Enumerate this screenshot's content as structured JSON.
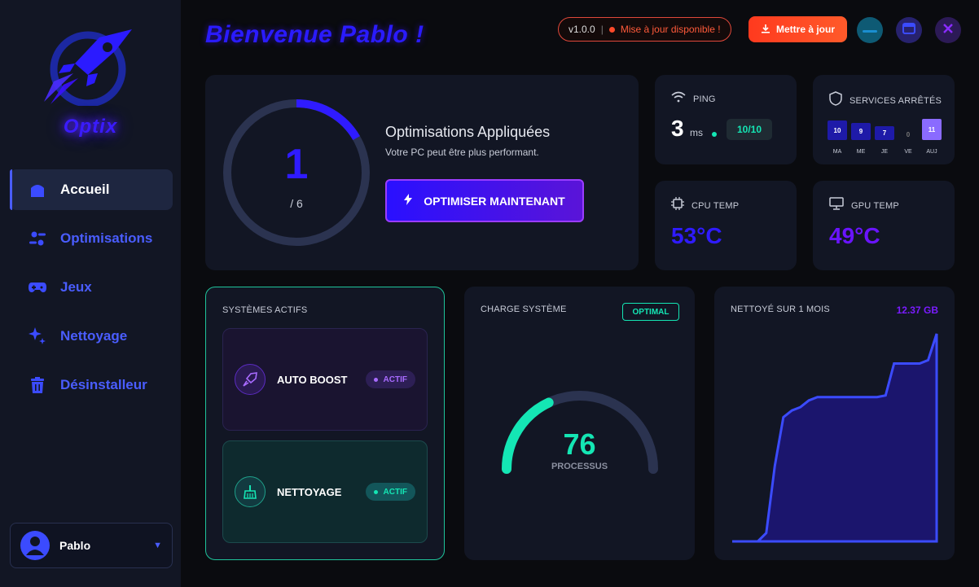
{
  "app": {
    "brand": "Optix"
  },
  "sidebar": {
    "items": [
      {
        "label": "Accueil",
        "icon": "home-icon",
        "active": true
      },
      {
        "label": "Optimisations",
        "icon": "sliders-icon",
        "active": false
      },
      {
        "label": "Jeux",
        "icon": "gamepad-icon",
        "active": false
      },
      {
        "label": "Nettoyage",
        "icon": "sparkles-icon",
        "active": false
      },
      {
        "label": "Désinstalleur",
        "icon": "trash-icon",
        "active": false
      }
    ],
    "user": {
      "name": "Pablo"
    }
  },
  "header": {
    "welcome": "Bienvenue Pablo !",
    "version": "v1.0.0",
    "separator": "|",
    "update_notice": "Mise à jour disponible !",
    "update_button": "Mettre à jour"
  },
  "optimizations": {
    "applied": "1",
    "total_label": "/ 6",
    "progress": 0.1667,
    "title": "Optimisations Appliquées",
    "subtitle": "Votre PC peut être plus performant.",
    "button": "OPTIMISER MAINTENANT"
  },
  "ping": {
    "title": "PING",
    "value": "3",
    "unit": "ms",
    "score": "10/10"
  },
  "services": {
    "title": "SERVICES ARRÊTÉS",
    "days": [
      {
        "label": "MA",
        "value": "10"
      },
      {
        "label": "ME",
        "value": "9"
      },
      {
        "label": "JE",
        "value": "7"
      },
      {
        "label": "VE",
        "value": "0"
      },
      {
        "label": "AUJ",
        "value": "11"
      }
    ]
  },
  "cpu": {
    "title": "CPU TEMP",
    "value": "53°C"
  },
  "gpu": {
    "title": "GPU TEMP",
    "value": "49°C"
  },
  "systems": {
    "title": "SYSTÈMES ACTIFS",
    "items": [
      {
        "label": "AUTO BOOST",
        "status": "ACTIF",
        "icon": "rocket-icon"
      },
      {
        "label": "NETTOYAGE",
        "status": "ACTIF",
        "icon": "broom-icon"
      }
    ]
  },
  "load": {
    "title": "CHARGE SYSTÈME",
    "badge": "OPTIMAL",
    "value": "76",
    "label": "PROCESSUS",
    "fraction": 0.36
  },
  "cleaned": {
    "title": "NETTOYÉ SUR 1 MOIS",
    "total": "12.37 GB",
    "chart_data": {
      "type": "area",
      "title": "NETTOYÉ SUR 1 MOIS",
      "y_unit": "GB",
      "values": [
        0,
        0,
        0,
        0,
        0.5,
        4.5,
        7.4,
        7.8,
        8.0,
        8.4,
        8.6,
        8.6,
        8.6,
        8.6,
        8.6,
        8.6,
        8.6,
        8.6,
        8.7,
        10.6,
        10.6,
        10.6,
        10.6,
        10.8,
        12.37
      ]
    }
  },
  "colors": {
    "accent": "#2f1bff",
    "teal": "#14e6b4",
    "orange": "#ff4a2a",
    "purple": "#7a1bff"
  }
}
